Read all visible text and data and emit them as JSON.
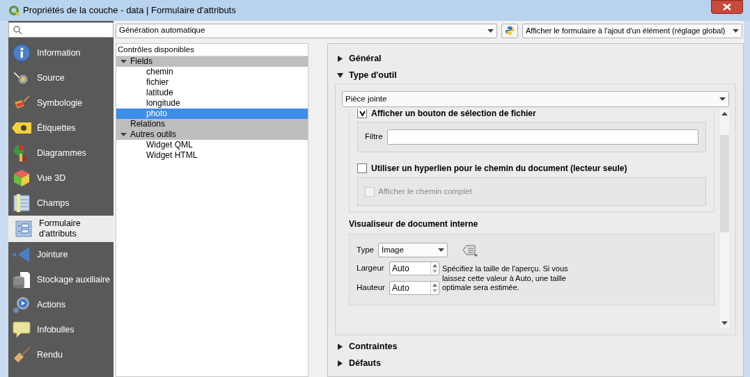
{
  "window": {
    "title": "Propriétés de la couche - data | Formulaire d'attributs"
  },
  "sidebar": {
    "items": [
      {
        "label": "Information",
        "selected": false
      },
      {
        "label": "Source",
        "selected": false
      },
      {
        "label": "Symbologie",
        "selected": false
      },
      {
        "label": "Étiquettes",
        "selected": false
      },
      {
        "label": "Diagrammes",
        "selected": false
      },
      {
        "label": "Vue 3D",
        "selected": false
      },
      {
        "label": "Champs",
        "selected": false
      },
      {
        "label": "Formulaire d'attributs",
        "selected": true
      },
      {
        "label": "Jointure",
        "selected": false
      },
      {
        "label": "Stockage auxiliaire",
        "selected": false
      },
      {
        "label": "Actions",
        "selected": false
      },
      {
        "label": "Infobulles",
        "selected": false
      },
      {
        "label": "Rendu",
        "selected": false
      }
    ]
  },
  "toolbar": {
    "layout_combo": "Génération automatique",
    "form_combo": "Afficher le formulaire à l'ajout d'un élément (réglage global)"
  },
  "tree": {
    "header": "Contrôles disponibles",
    "nodes": [
      {
        "label": "Fields",
        "expanded": true,
        "selected": false,
        "children": [
          {
            "label": "chemin",
            "selected": false
          },
          {
            "label": "fichier",
            "selected": false
          },
          {
            "label": "latitude",
            "selected": false
          },
          {
            "label": "longitude",
            "selected": false
          },
          {
            "label": "photo",
            "selected": true
          }
        ]
      },
      {
        "label": "Relations",
        "expanded": false,
        "selected": false
      },
      {
        "label": "Autres outils",
        "expanded": true,
        "selected": false,
        "children": [
          {
            "label": "Widget QML",
            "selected": false
          },
          {
            "label": "Widget HTML",
            "selected": false
          }
        ]
      }
    ]
  },
  "sections": [
    {
      "title": "Général",
      "expanded": false
    },
    {
      "title": "Type d'outil",
      "expanded": true
    },
    {
      "title": "Contraintes",
      "expanded": false
    },
    {
      "title": "Défauts",
      "expanded": false
    }
  ],
  "widget": {
    "type": "Pièce jointe",
    "file_button": {
      "label": "Afficher un bouton de sélection de fichier",
      "checked": true
    },
    "filter": {
      "label": "Filtre"
    },
    "hyperlink": {
      "label": "Utiliser un hyperlien pour le chemin du document (lecteur seule)",
      "checked": false
    },
    "full_path": {
      "label": "Afficher le chemin complet",
      "checked": false,
      "disabled": true
    },
    "viewer": {
      "title": "Visualiseur de document interne",
      "type_label": "Type",
      "type_value": "Image",
      "width_label": "Largeur",
      "width_value": "Auto",
      "height_label": "Hauteur",
      "height_value": "Auto",
      "hint": "Spécifiez la taille de l'aperçu. Si vous laissez cette valeur à Auto, une taille optimale sera estimée."
    }
  }
}
